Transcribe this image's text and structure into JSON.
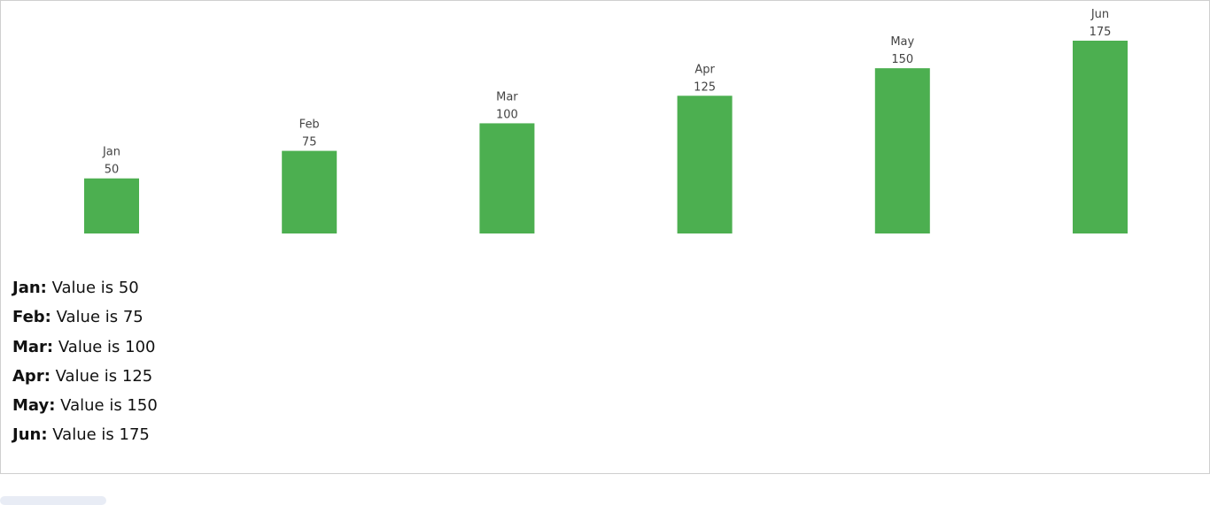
{
  "chart_data": {
    "type": "bar",
    "categories": [
      "Jan",
      "Feb",
      "Mar",
      "Apr",
      "May",
      "Jun"
    ],
    "values": [
      50,
      75,
      100,
      125,
      150,
      175
    ],
    "title": "",
    "xlabel": "",
    "ylabel": "",
    "ylim": [
      0,
      175
    ],
    "bar_color": "#4caf50",
    "grid": false,
    "legend": "none"
  },
  "details": [
    {
      "category": "Jan:",
      "text": "Value is 50"
    },
    {
      "category": "Feb:",
      "text": "Value is 75"
    },
    {
      "category": "Mar:",
      "text": "Value is 100"
    },
    {
      "category": "Apr:",
      "text": "Value is 125"
    },
    {
      "category": "May:",
      "text": "Value is 150"
    },
    {
      "category": "Jun:",
      "text": "Value is 175"
    }
  ],
  "colors": {
    "tab_accent": "#1a73e8",
    "panel_border": "#cfcfcf"
  }
}
